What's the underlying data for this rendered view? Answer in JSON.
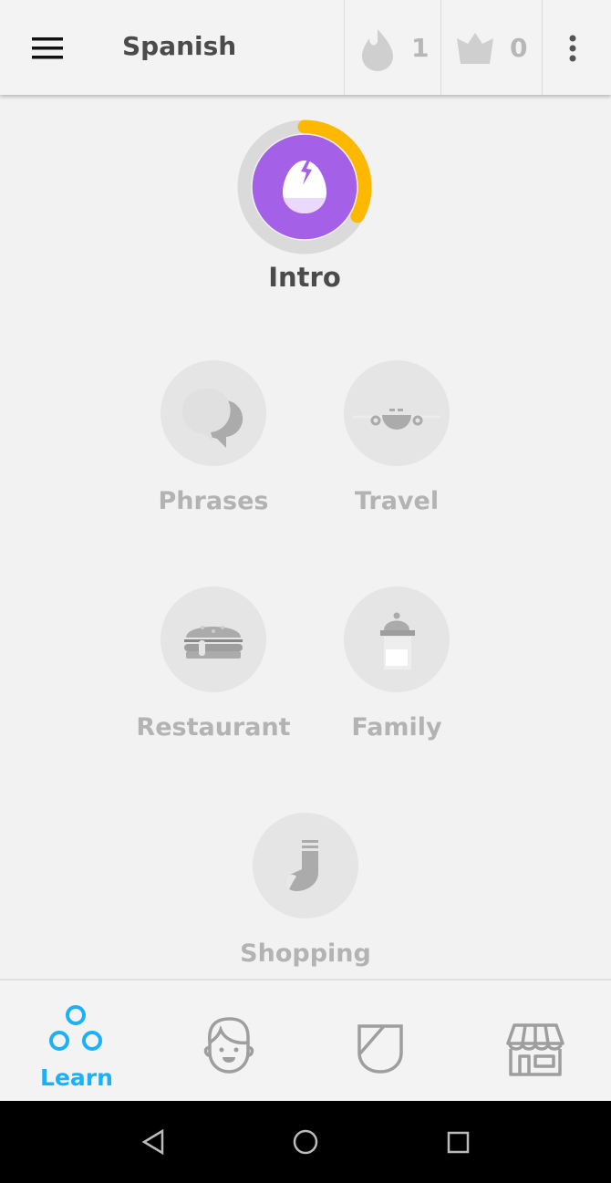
{
  "header": {
    "title": "Spanish",
    "streak_count": "1",
    "crowns_count": "0",
    "icons": [
      "menu-icon",
      "flame-icon",
      "crown-icon",
      "more-vert-icon"
    ]
  },
  "intro": {
    "label": "Intro",
    "progress": 0.33,
    "colors": {
      "circle": "#a560e8",
      "ring": "#ffb800",
      "track": "#dadada"
    }
  },
  "skills": [
    {
      "label": "Phrases",
      "icon": "speech-bubbles-icon"
    },
    {
      "label": "Travel",
      "icon": "airplane-icon"
    },
    {
      "label": "Restaurant",
      "icon": "burger-icon"
    },
    {
      "label": "Family",
      "icon": "baby-bottle-icon"
    },
    {
      "label": "Shopping",
      "icon": "sock-icon"
    }
  ],
  "bottom_nav": {
    "active_color": "#1cb0f6",
    "items": [
      {
        "label": "Learn",
        "icon": "learn-icon",
        "active": true
      },
      {
        "icon": "profile-face-icon"
      },
      {
        "icon": "shield-icon"
      },
      {
        "icon": "shop-icon"
      }
    ]
  },
  "system_nav": {
    "icons": [
      "back-icon",
      "home-icon",
      "recents-icon"
    ]
  }
}
